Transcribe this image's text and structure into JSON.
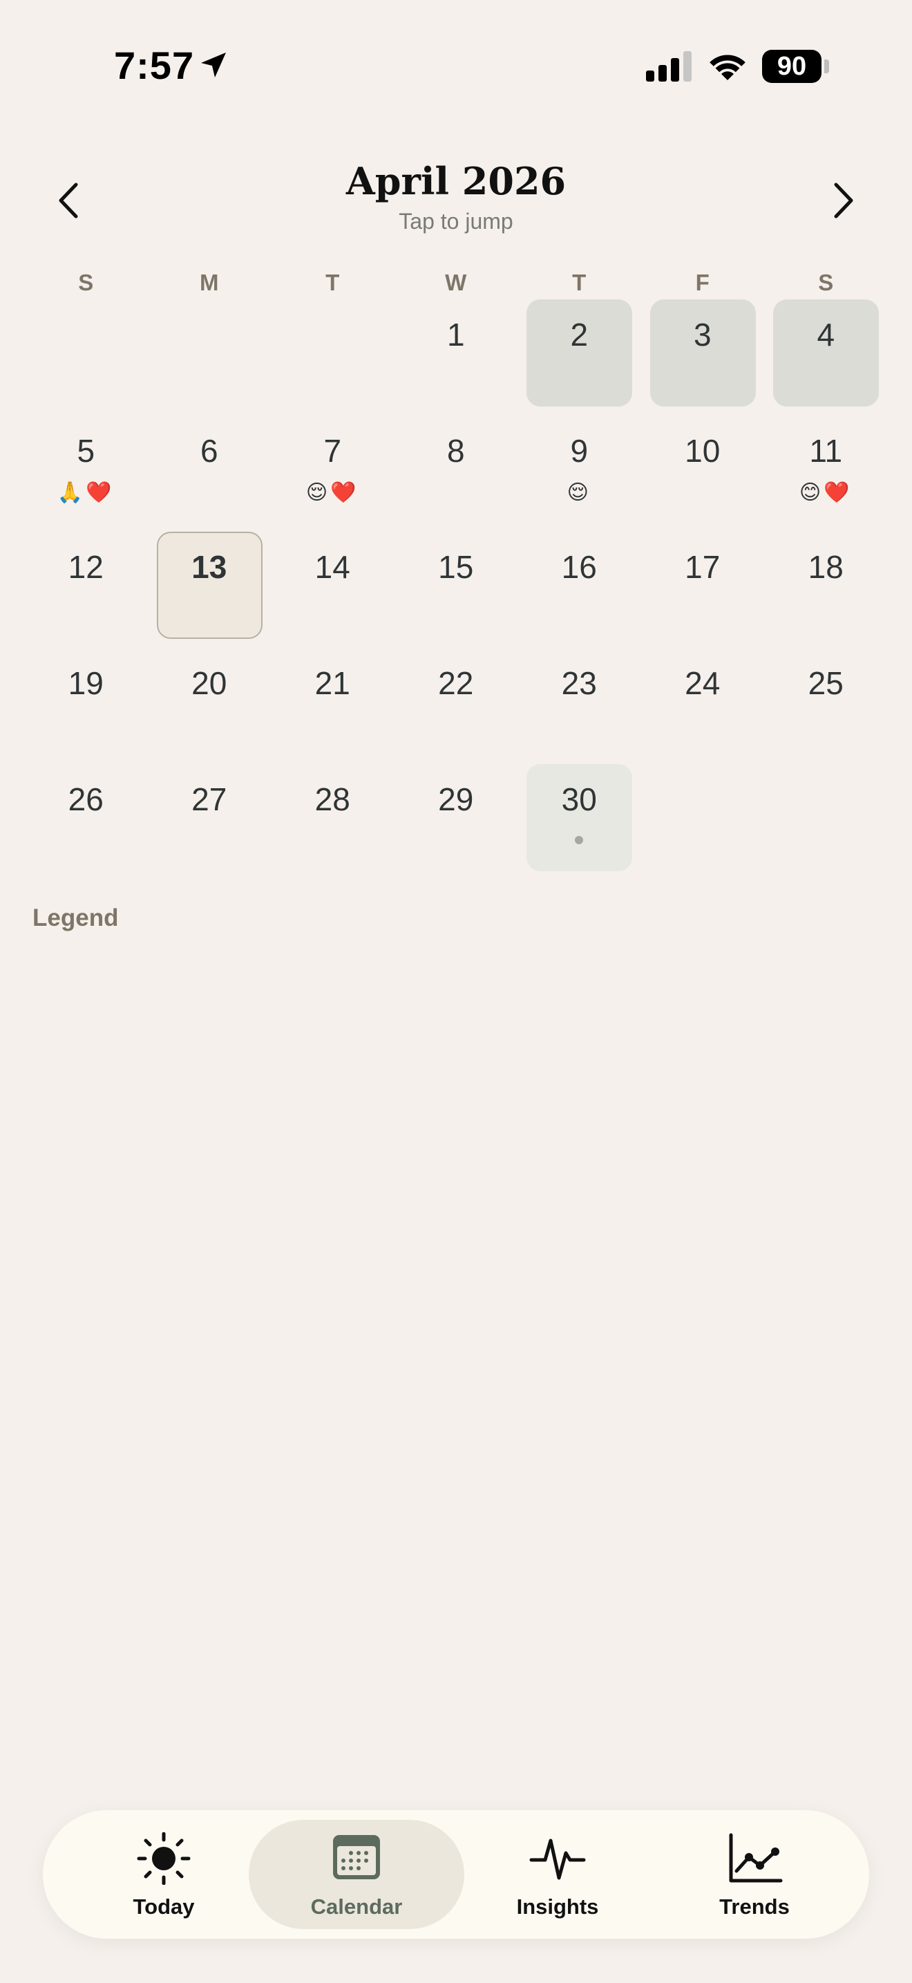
{
  "status_bar": {
    "time": "7:57",
    "battery": "90",
    "icons": [
      "location-arrow-icon",
      "cellular-signal-icon",
      "wifi-icon",
      "battery-icon"
    ]
  },
  "header": {
    "title": "April 2026",
    "subtitle": "Tap to jump",
    "prev_icon": "chevron-left-icon",
    "next_icon": "chevron-right-icon"
  },
  "weekdays": [
    "S",
    "M",
    "T",
    "W",
    "T",
    "F",
    "S"
  ],
  "weeks": [
    [
      {
        "day": "",
        "style": "empty",
        "emoji": ""
      },
      {
        "day": "",
        "style": "empty",
        "emoji": ""
      },
      {
        "day": "",
        "style": "empty",
        "emoji": ""
      },
      {
        "day": "1",
        "style": "plain",
        "emoji": ""
      },
      {
        "day": "2",
        "style": "shaded",
        "emoji": ""
      },
      {
        "day": "3",
        "style": "shaded",
        "emoji": ""
      },
      {
        "day": "4",
        "style": "shaded",
        "emoji": ""
      }
    ],
    [
      {
        "day": "5",
        "style": "plain",
        "emoji": "🙏❤️"
      },
      {
        "day": "6",
        "style": "plain",
        "emoji": ""
      },
      {
        "day": "7",
        "style": "plain",
        "emoji": "😌❤️"
      },
      {
        "day": "8",
        "style": "plain",
        "emoji": ""
      },
      {
        "day": "9",
        "style": "plain",
        "emoji": "😌"
      },
      {
        "day": "10",
        "style": "plain",
        "emoji": ""
      },
      {
        "day": "11",
        "style": "plain",
        "emoji": "😊❤️"
      }
    ],
    [
      {
        "day": "12",
        "style": "plain",
        "emoji": ""
      },
      {
        "day": "13",
        "style": "today",
        "emoji": ""
      },
      {
        "day": "14",
        "style": "plain",
        "emoji": ""
      },
      {
        "day": "15",
        "style": "plain",
        "emoji": ""
      },
      {
        "day": "16",
        "style": "plain",
        "emoji": ""
      },
      {
        "day": "17",
        "style": "plain",
        "emoji": ""
      },
      {
        "day": "18",
        "style": "plain",
        "emoji": ""
      }
    ],
    [
      {
        "day": "19",
        "style": "plain",
        "emoji": ""
      },
      {
        "day": "20",
        "style": "plain",
        "emoji": ""
      },
      {
        "day": "21",
        "style": "plain",
        "emoji": ""
      },
      {
        "day": "22",
        "style": "plain",
        "emoji": ""
      },
      {
        "day": "23",
        "style": "plain",
        "emoji": ""
      },
      {
        "day": "24",
        "style": "plain",
        "emoji": ""
      },
      {
        "day": "25",
        "style": "plain",
        "emoji": ""
      }
    ],
    [
      {
        "day": "26",
        "style": "plain",
        "emoji": ""
      },
      {
        "day": "27",
        "style": "plain",
        "emoji": ""
      },
      {
        "day": "28",
        "style": "plain",
        "emoji": ""
      },
      {
        "day": "29",
        "style": "plain",
        "emoji": ""
      },
      {
        "day": "30",
        "style": "light",
        "emoji": "",
        "dot": true
      },
      {
        "day": "",
        "style": "empty",
        "emoji": ""
      },
      {
        "day": "",
        "style": "empty",
        "emoji": ""
      }
    ]
  ],
  "legend": {
    "label": "Legend"
  },
  "tabs": [
    {
      "label": "Today",
      "icon": "sun-icon",
      "active": false
    },
    {
      "label": "Calendar",
      "icon": "calendar-icon",
      "active": true
    },
    {
      "label": "Insights",
      "icon": "pulse-icon",
      "active": false
    },
    {
      "label": "Trends",
      "icon": "line-chart-icon",
      "active": false
    }
  ],
  "colors": {
    "background": "#f5f0eb",
    "shaded_day": "#dcdcd6",
    "today_day": "#efe8df",
    "accent": "#5d6b5e",
    "tabbar": "#fdfaf2"
  }
}
